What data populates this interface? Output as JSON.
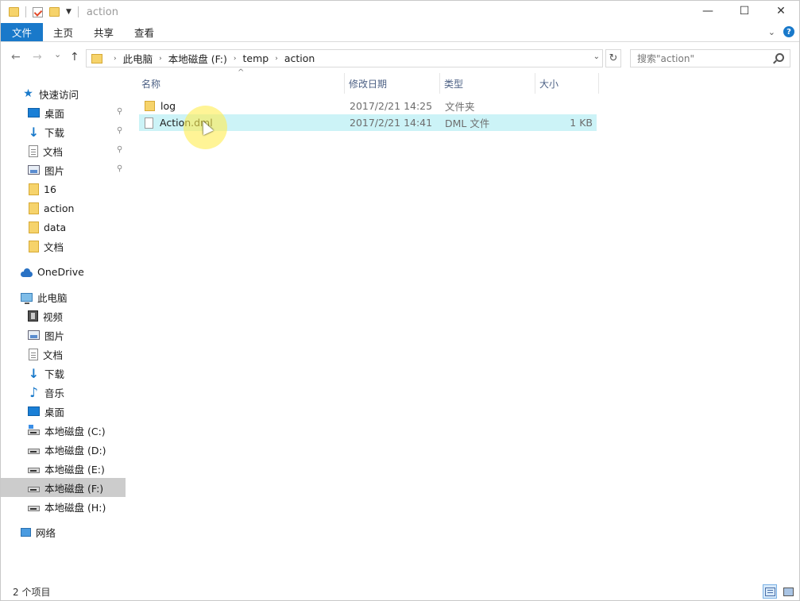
{
  "title": {
    "text": "action"
  },
  "window_controls": {
    "minimize": "—",
    "maximize": "☐",
    "close": "✕"
  },
  "ribbon": {
    "tabs": [
      {
        "label": "文件"
      },
      {
        "label": "主页"
      },
      {
        "label": "共享"
      },
      {
        "label": "查看"
      }
    ],
    "help": "?"
  },
  "nav": {
    "back": "←",
    "forward": "→",
    "recent": "⌄",
    "up": "↑"
  },
  "address": {
    "crumbs": [
      "此电脑",
      "本地磁盘 (F:)",
      "temp",
      "action"
    ]
  },
  "search": {
    "placeholder": "搜索\"action\""
  },
  "sidebar": {
    "quick_access": "快速访问",
    "quick_items": [
      {
        "label": "桌面"
      },
      {
        "label": "下载"
      },
      {
        "label": "文档"
      },
      {
        "label": "图片"
      },
      {
        "label": "16"
      },
      {
        "label": "action"
      },
      {
        "label": "data"
      },
      {
        "label": "文档"
      }
    ],
    "onedrive": "OneDrive",
    "this_pc": "此电脑",
    "pc_items": [
      {
        "label": "视频"
      },
      {
        "label": "图片"
      },
      {
        "label": "文档"
      },
      {
        "label": "下载"
      },
      {
        "label": "音乐"
      },
      {
        "label": "桌面"
      },
      {
        "label": "本地磁盘 (C:)"
      },
      {
        "label": "本地磁盘 (D:)"
      },
      {
        "label": "本地磁盘 (E:)"
      },
      {
        "label": "本地磁盘 (F:)"
      },
      {
        "label": "本地磁盘 (H:)"
      }
    ],
    "network": "网络"
  },
  "columns": {
    "name": "名称",
    "date": "修改日期",
    "type": "类型",
    "size": "大小"
  },
  "files": [
    {
      "name": "log",
      "date": "2017/2/21 14:25",
      "type": "文件夹",
      "size": ""
    },
    {
      "name": "Action.dml",
      "date": "2017/2/21 14:41",
      "type": "DML 文件",
      "size": "1 KB"
    }
  ],
  "status": {
    "count": "2 个项目"
  }
}
